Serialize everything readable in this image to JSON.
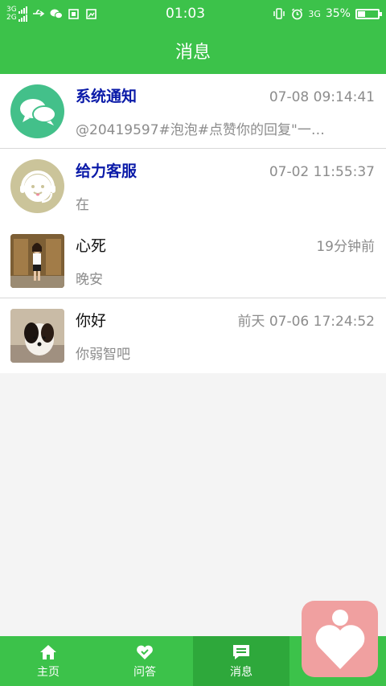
{
  "status_bar": {
    "sim1": "3G",
    "sim2": "2G",
    "time": "01:03",
    "network": "3G",
    "battery_text": "35%",
    "battery_level": 0.35
  },
  "header": {
    "title": "消息"
  },
  "messages": [
    {
      "name": "系统通知",
      "time": "07-08 09:14:41",
      "preview": "@20419597#泡泡#点赞你的回复\"一…",
      "avatar": "chat-bubbles-icon"
    },
    {
      "name": "给力客服",
      "time": "07-02 11:55:37",
      "preview": "在",
      "avatar": "customer-service-icon"
    },
    {
      "name": "心死",
      "time": "19分钟前",
      "preview": "晚安",
      "avatar": "user-photo-girl"
    },
    {
      "name": "你好",
      "time": "前天 07-06 17:24:52",
      "preview": "你弱智吧",
      "avatar": "user-photo-puppy"
    }
  ],
  "tabs": [
    {
      "label": "主页",
      "icon": "home-icon"
    },
    {
      "label": "问答",
      "icon": "heart-icon"
    },
    {
      "label": "消息",
      "icon": "message-icon"
    },
    {
      "label": "",
      "icon": "profile-icon"
    }
  ],
  "colors": {
    "primary": "#3cc24a",
    "active_tab": "#2ea83b",
    "name_highlight": "#0a1aa8",
    "floating_button": "#f0a0a0"
  }
}
